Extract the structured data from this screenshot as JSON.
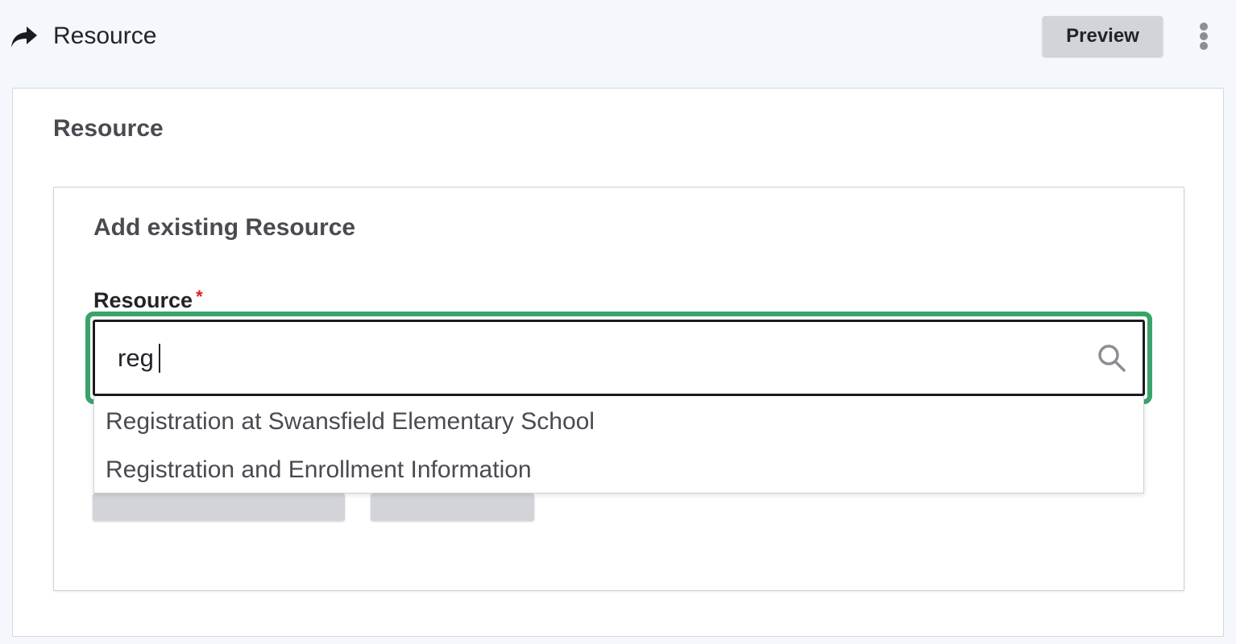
{
  "header": {
    "title": "Resource",
    "back_icon": "share-forward-icon",
    "preview_label": "Preview",
    "menu_icon": "more-vertical-icon"
  },
  "section": {
    "title": "Resource"
  },
  "add_existing": {
    "title": "Add existing Resource",
    "field_label": "Resource",
    "required_marker": "*",
    "search_value": "reg",
    "search_icon": "search-icon",
    "focus_color": "#3aa36b"
  },
  "autocomplete": {
    "options": [
      {
        "label": "Registration at Swansfield Elementary School"
      },
      {
        "label": "Registration and Enrollment Information"
      }
    ]
  }
}
